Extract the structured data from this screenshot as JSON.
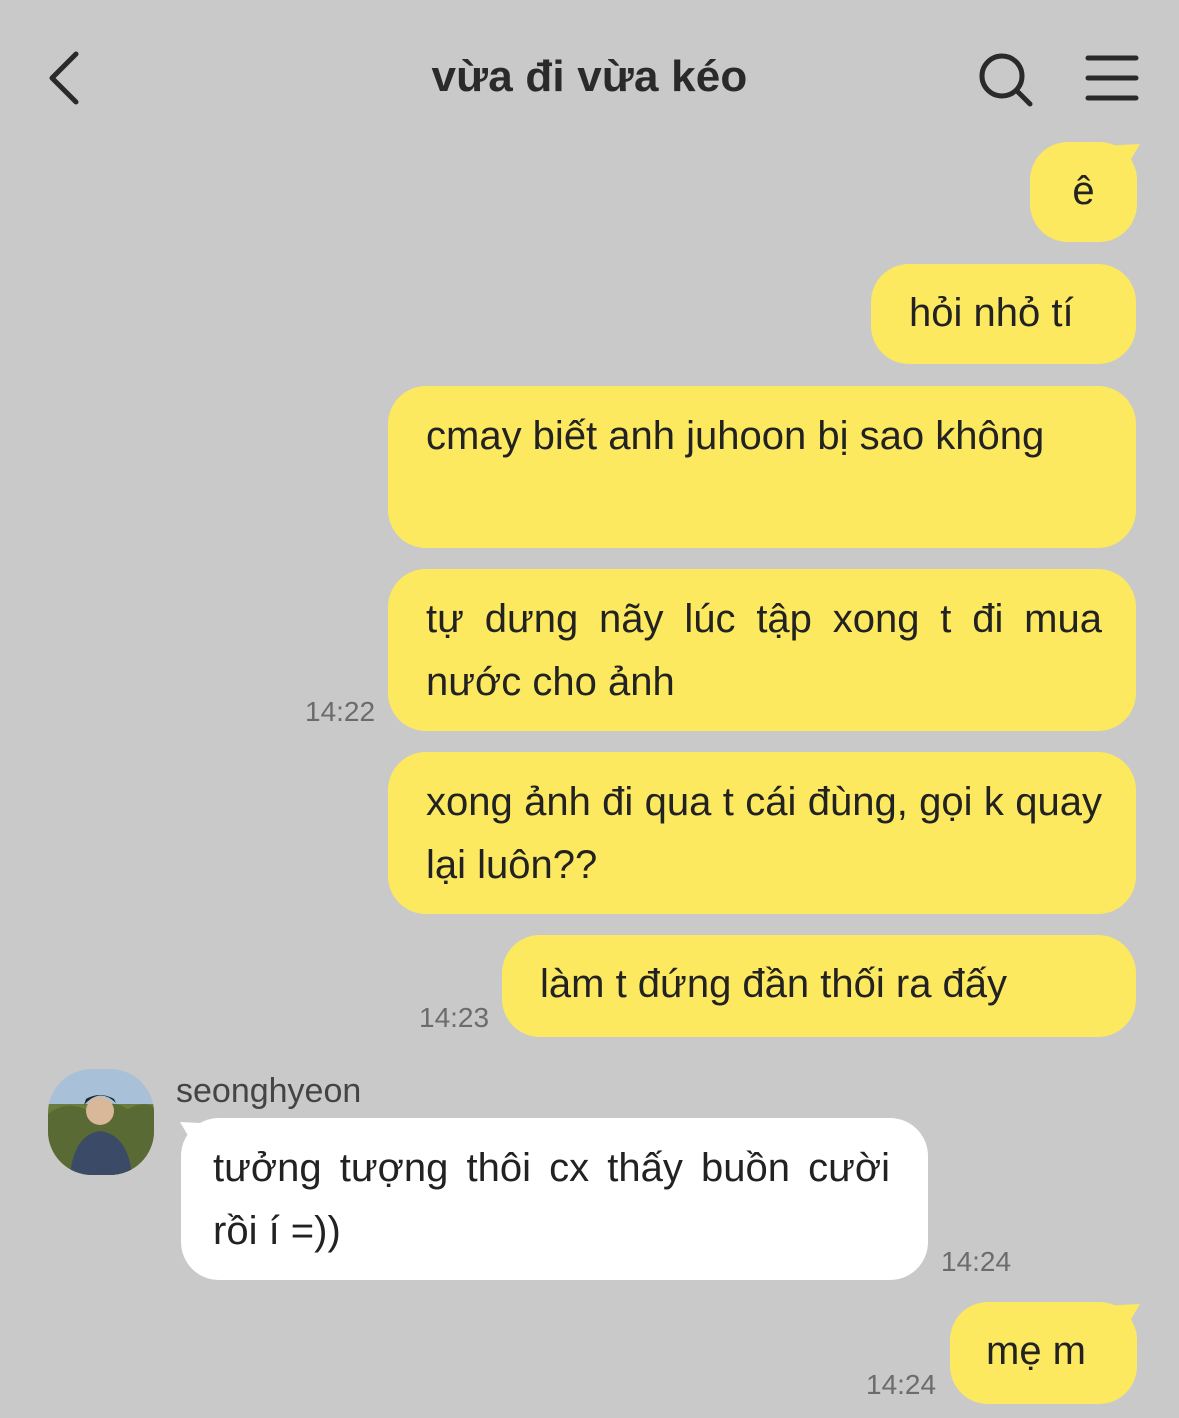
{
  "header": {
    "title": "vừa đi vừa kéo",
    "back_icon": "chevron-left-icon",
    "search_icon": "search-icon",
    "menu_icon": "hamburger-menu-icon"
  },
  "colors": {
    "background": "#c9c9c9",
    "my_bubble": "#fce960",
    "their_bubble": "#ffffff",
    "timestamp": "#6c6c6c"
  },
  "messages": [
    {
      "from": "me",
      "text": "ê"
    },
    {
      "from": "me",
      "text": "hỏi nhỏ tí"
    },
    {
      "from": "me",
      "text": "cmay biết anh juhoon bị sao không"
    },
    {
      "from": "me",
      "text": "tự dưng nãy lúc tập xong t đi mua nước cho ảnh",
      "time": "14:22"
    },
    {
      "from": "me",
      "text": "xong ảnh đi qua t cái đùng, gọi k quay lại luôn??"
    },
    {
      "from": "me",
      "text": "làm t đứng đần thối ra đấy",
      "time": "14:23"
    },
    {
      "from": "them",
      "sender": "seonghyeon",
      "text": "tưởng tượng thôi cx thấy buồn cười rồi í =))",
      "time": "14:24"
    },
    {
      "from": "me",
      "text": "mẹ m",
      "time": "14:24"
    }
  ]
}
